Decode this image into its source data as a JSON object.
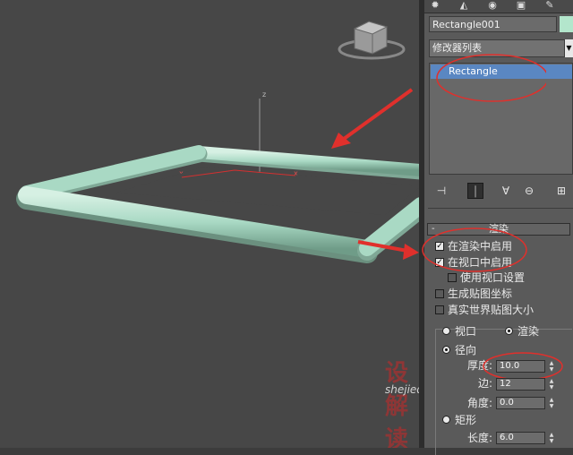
{
  "panel": {
    "tabs": [
      "✹",
      "◭",
      "◉",
      "▣",
      "✎"
    ],
    "object_name": "Rectangle001",
    "object_color": "#b3e6cc",
    "modifier_list": "修改器列表",
    "stack_item": "Rectangle"
  },
  "toolbar": {
    "icons": [
      "pin-stack-icon",
      "show-end-result-icon",
      "make-unique-icon",
      "remove-modifier-icon",
      "configure-modifier-sets-icon"
    ]
  },
  "rendering": {
    "header": "渲染",
    "enable_in_renderer": {
      "label": "在渲染中启用",
      "checked": true
    },
    "enable_in_viewport": {
      "label": "在视口中启用",
      "checked": true
    },
    "use_viewport_settings": {
      "label": "使用视口设置",
      "checked": false
    },
    "generate_mapping_coords": {
      "label": "生成贴图坐标",
      "checked": false
    },
    "real_world_map_size": {
      "label": "真实世界贴图大小",
      "checked": false
    },
    "viewport_radio": "视口",
    "renderer_radio": "渲染",
    "radial_radio": "径向",
    "thickness_label": "厚度:",
    "thickness_value": "10.0",
    "sides_label": "边:",
    "sides_value": "12",
    "angle_label": "角度:",
    "angle_value": "0.0",
    "rectangular_radio": "矩形",
    "length_label": "长度:",
    "length_value": "6.0"
  },
  "viewport": {
    "axis_z": "z",
    "axis_x": "x",
    "tube_color": "#a9d9c4",
    "annotation_color": "#e0302c"
  },
  "watermark": {
    "logo": "设解读",
    "url": "shejiedu.com"
  }
}
